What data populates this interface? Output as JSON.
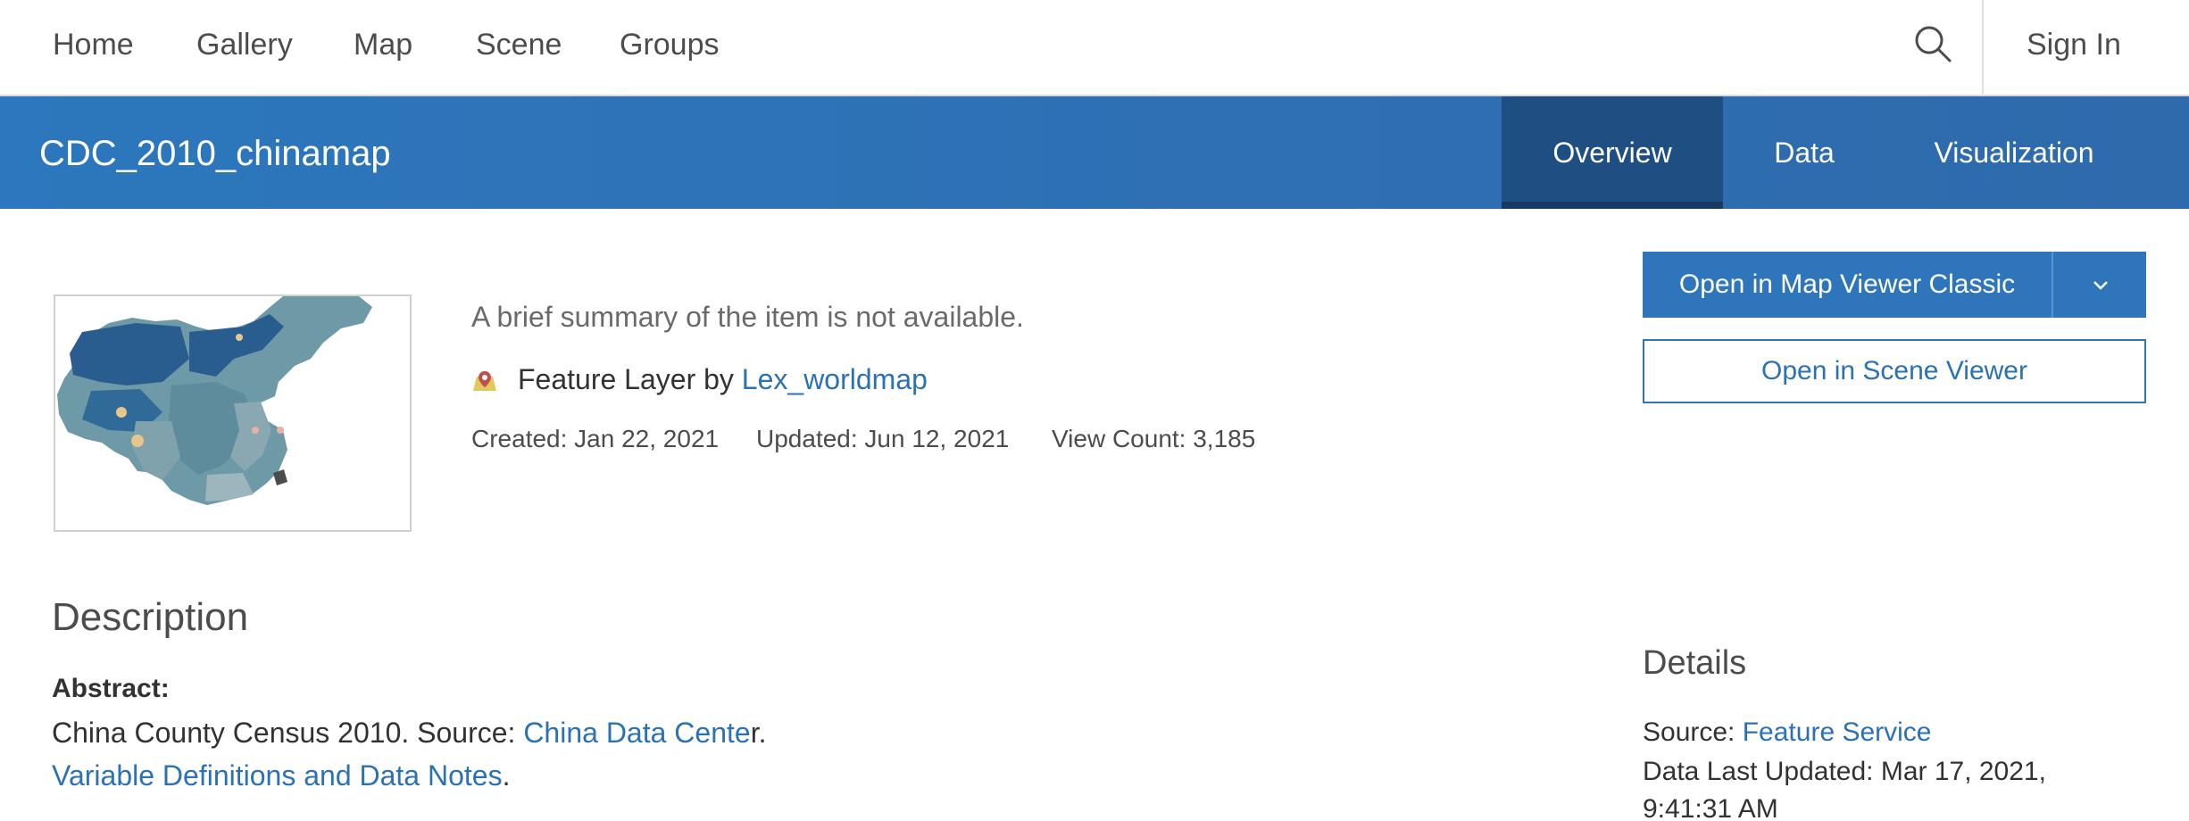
{
  "nav": {
    "items": [
      "Home",
      "Gallery",
      "Map",
      "Scene",
      "Groups"
    ],
    "sign_in": "Sign In",
    "search_icon": "search-icon"
  },
  "header": {
    "title": "CDC_2010_chinamap",
    "tabs": [
      "Overview",
      "Data",
      "Visualization"
    ],
    "active_tab": "Overview"
  },
  "item": {
    "summary": "A brief summary of the item is not available.",
    "type_label": "Feature Layer by",
    "owner": "Lex_worldmap",
    "created": "Created: Jan 22, 2021",
    "updated": "Updated: Jun 12, 2021",
    "view_count": "View Count: 3,185"
  },
  "actions": {
    "open_map_viewer": "Open in Map Viewer Classic",
    "open_scene_viewer": "Open in Scene Viewer"
  },
  "description": {
    "title": "Description",
    "abstract_label": "Abstract:",
    "abstract_text": "China County Census 2010.   Source: ",
    "source_link": "China Data Cente",
    "source_suffix": "r.",
    "variable_link": "Variable Definitions and Data Notes",
    "variable_suffix": "."
  },
  "details": {
    "title": "Details",
    "source_label": "Source: ",
    "source_link": "Feature Service",
    "last_updated": "Data Last Updated: Mar 17, 2021, 9:41:31 AM"
  },
  "colors": {
    "header_blue": "#2c77bd",
    "active_tab": "#1f4f82",
    "link": "#2b71b5",
    "button": "#2e75bb"
  }
}
